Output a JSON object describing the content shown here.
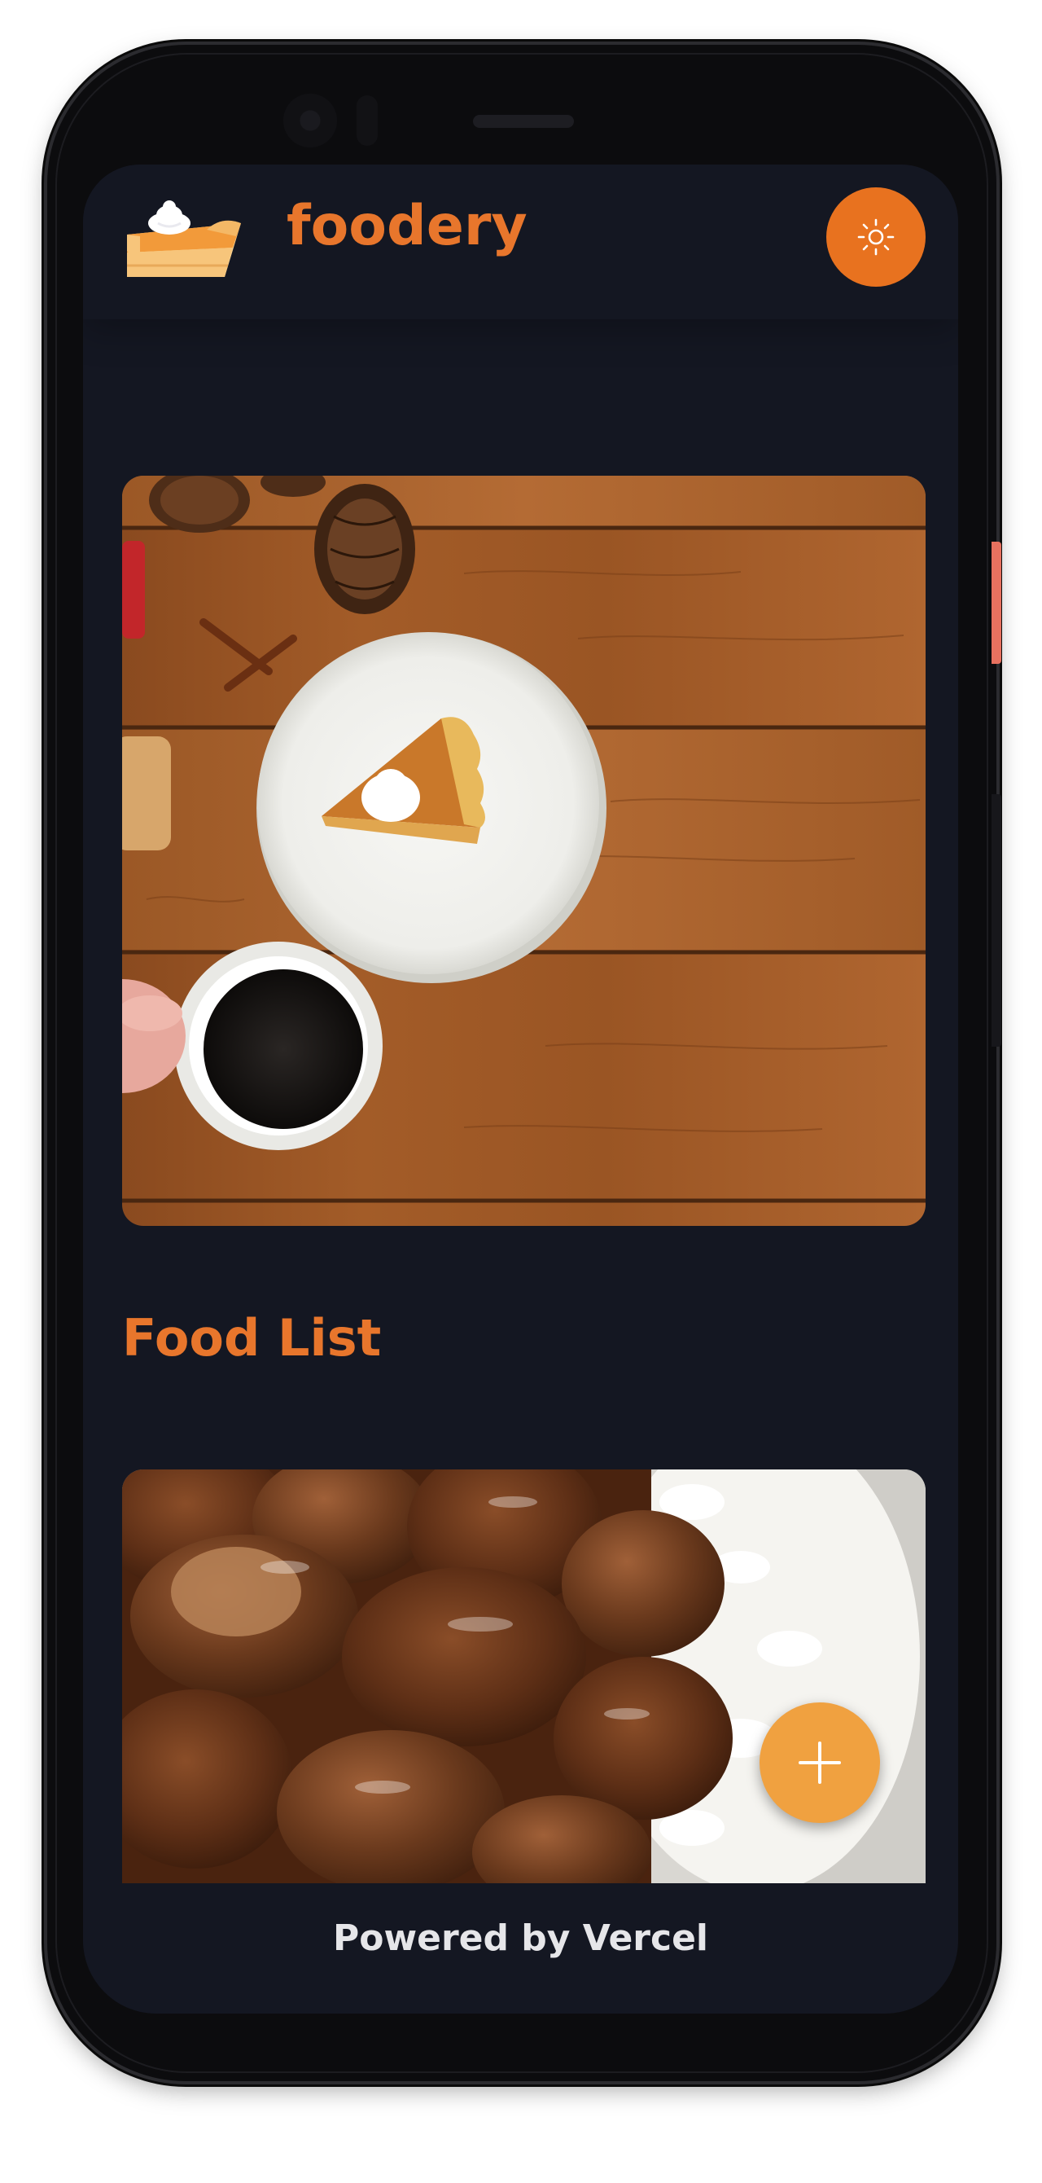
{
  "header": {
    "logo_icon": "pumpkin-pie-slice-icon",
    "brand": "foodery",
    "theme_toggle_icon": "sun-icon"
  },
  "hero": {
    "image": "pumpkin-pie-on-wooden-table"
  },
  "food_list": {
    "title": "Food List",
    "items": [
      {
        "image": "braised-pork-over-rice"
      }
    ],
    "add_button_icon": "plus-icon"
  },
  "footer": {
    "text": "Powered by Vercel"
  },
  "colors": {
    "background": "#141722",
    "accent": "#e8762c",
    "toggle": "#e8721f",
    "add_button": "#f0a140",
    "footer_text": "#e6e6e9"
  }
}
